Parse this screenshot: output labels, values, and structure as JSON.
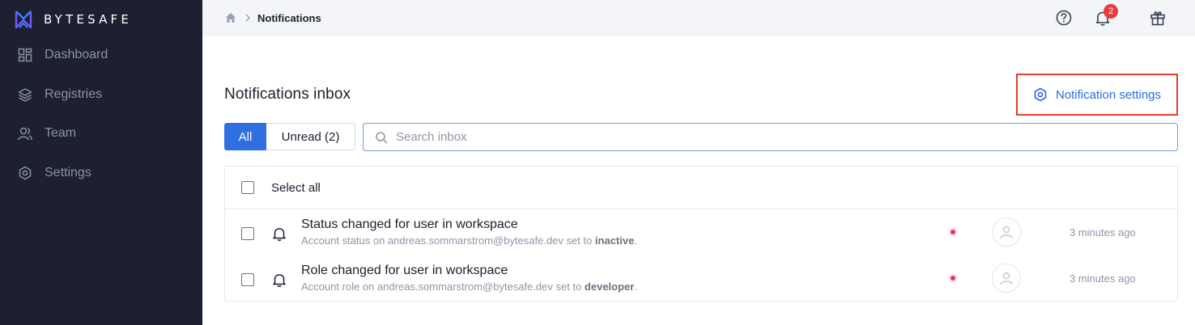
{
  "app": {
    "brand": "BYTESAFE",
    "colors": {
      "sidebar_bg": "#1c2030",
      "accent": "#2f6fe0",
      "highlight_border": "#e53e2e",
      "badge": "#e53e3e",
      "unread_dot": "#e0336e"
    }
  },
  "sidebar": {
    "items": [
      {
        "label": "Dashboard",
        "icon": "dashboard-icon"
      },
      {
        "label": "Registries",
        "icon": "layers-icon"
      },
      {
        "label": "Team",
        "icon": "team-icon"
      },
      {
        "label": "Settings",
        "icon": "gear-icon"
      }
    ]
  },
  "header": {
    "breadcrumb": {
      "home_icon": "home-icon",
      "current": "Notifications"
    },
    "icons": [
      "help-icon",
      "bell-icon",
      "gift-icon"
    ],
    "notification_count": "2"
  },
  "main": {
    "title": "Notifications inbox",
    "settings_button": "Notification settings",
    "tabs": {
      "all": "All",
      "unread": "Unread (2)"
    },
    "search": {
      "placeholder": "Search inbox",
      "value": ""
    },
    "select_all": "Select all",
    "notifications": [
      {
        "title": "Status changed for user in workspace",
        "desc_prefix": "Account status on andreas.sommarstrom@bytesafe.dev set to ",
        "desc_value": "inactive",
        "desc_suffix": ".",
        "time": "3 minutes ago",
        "unread": true
      },
      {
        "title": "Role changed for user in workspace",
        "desc_prefix": "Account role on andreas.sommarstrom@bytesafe.dev set to ",
        "desc_value": "developer",
        "desc_suffix": ".",
        "time": "3 minutes ago",
        "unread": true
      }
    ]
  }
}
